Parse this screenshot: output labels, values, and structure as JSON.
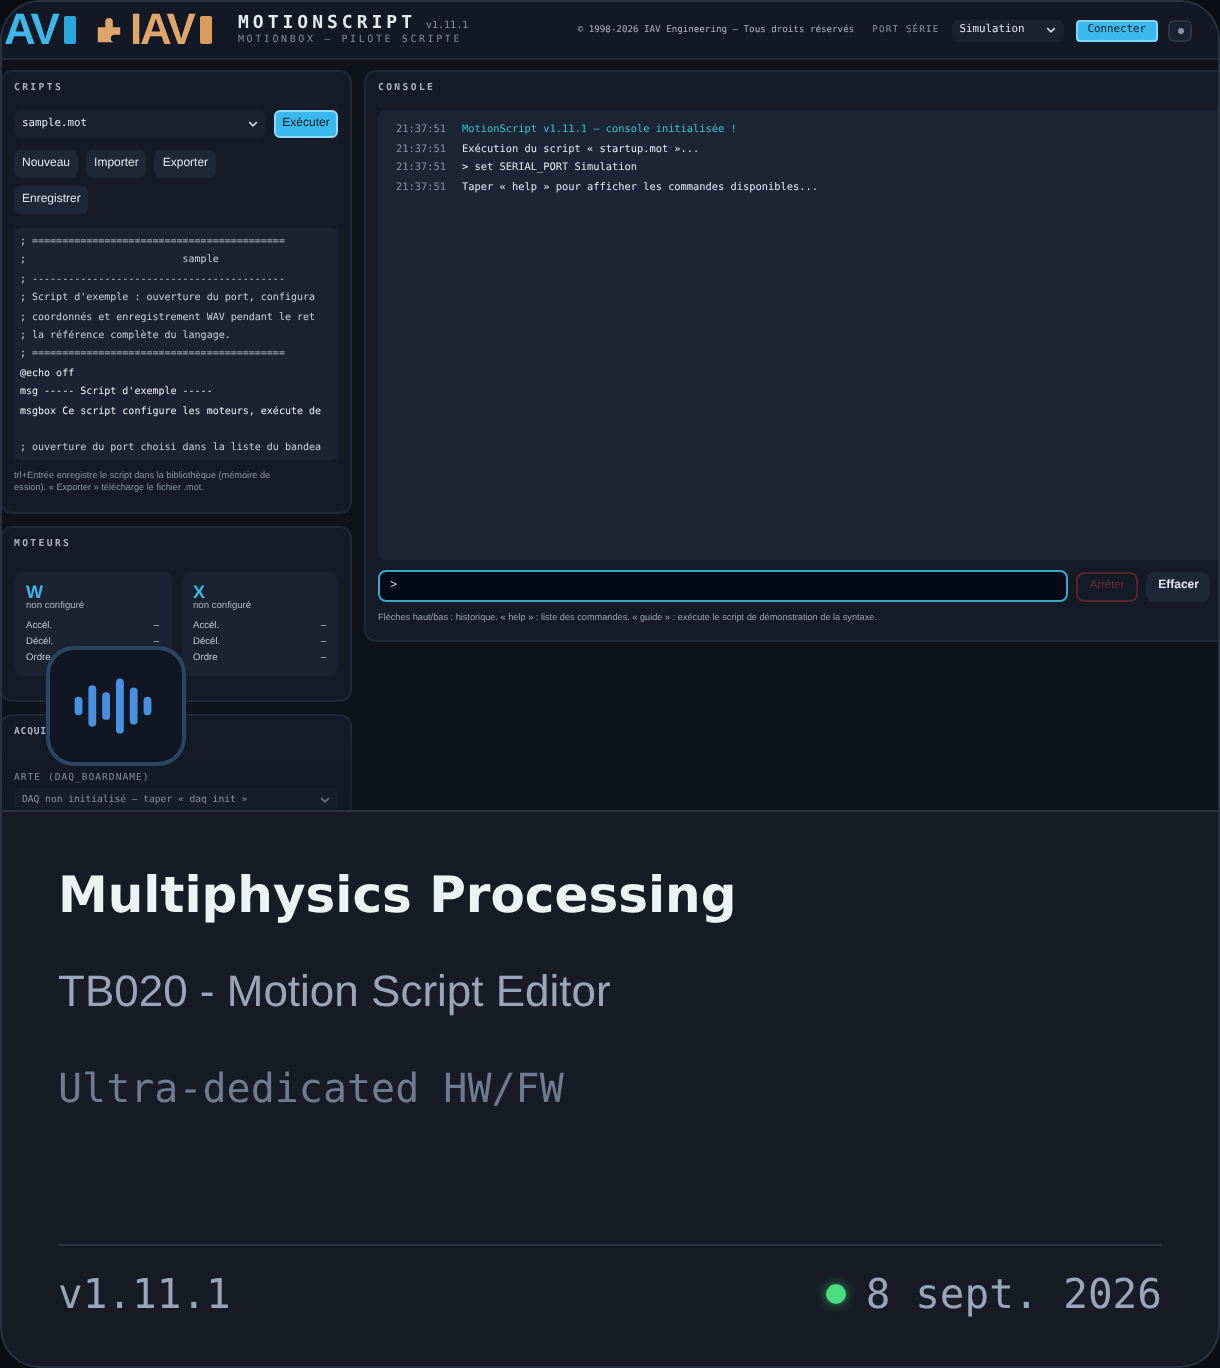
{
  "preview": {
    "header": {
      "logos": [
        "AV",
        "IAV"
      ],
      "title": "MOTIONSCRIPT",
      "version": "v1.11.1",
      "subtitle": "MOTIONBOX — PILOTE SCRIPTE",
      "copyright": "© 1998-2026 IAV Engineering — Tous droits réservés",
      "port_label": "PORT SÉRIE",
      "port_value": "Simulation",
      "connect_button": "Connecter"
    },
    "scripts": {
      "heading": "CRIPTS",
      "file": "sample.mot",
      "run_button": "Exécuter",
      "buttons": [
        "Nouveau",
        "Importer",
        "Exporter",
        "Enregistrer"
      ],
      "code_blocks": [
        [
          {
            "text": "; ==========================================",
            "kind": "comment"
          },
          {
            "text": ";                          sample",
            "kind": "comment"
          },
          {
            "text": "; ------------------------------------------",
            "kind": "comment"
          },
          {
            "text": "; Script d'exemple : ouverture du port, configura",
            "kind": "comment"
          },
          {
            "text": "; coordonnés et enregistrement WAV pendant le ret",
            "kind": "comment"
          },
          {
            "text": "; la référence complète du langage.",
            "kind": "comment"
          },
          {
            "text": "; ==========================================",
            "kind": "comment"
          },
          {
            "text": "@echo off",
            "kind": "command"
          },
          {
            "text": "msg ----- Script d'exemple -----",
            "kind": "command"
          },
          {
            "text": "msgbox Ce script configure les moteurs, exécute de",
            "kind": "command"
          }
        ],
        [
          {
            "text": "; ouverture du port choisi dans la liste du bandea",
            "kind": "comment"
          }
        ]
      ],
      "help_lines": [
        "trl+Entrée enregistre le script dans la bibliothèque (mémoire de",
        "ession). « Exporter » télécharge le fichier .mot."
      ]
    },
    "motors": {
      "heading": "MOTEURS",
      "items": [
        {
          "axis": "W",
          "status": "non configuré",
          "params": [
            {
              "label": "Accél.",
              "value": "–"
            },
            {
              "label": "Décél.",
              "value": "–"
            },
            {
              "label": "Ordre"
            }
          ]
        },
        {
          "axis": "X",
          "status": "non configuré",
          "params": [
            {
              "label": "Accél.",
              "value": "–"
            },
            {
              "label": "Décél.",
              "value": "–"
            },
            {
              "label": "Ordre",
              "value": "–"
            }
          ]
        }
      ]
    },
    "acquisition": {
      "heading": "ACQUI",
      "field_label": "ARTE (DAQ_BOARDNAME)",
      "select_value": "DAQ non initialisé — taper « daq init »"
    },
    "console": {
      "heading": "CONSOLE",
      "lines": [
        {
          "time": "21:37:51",
          "text": "MotionScript v1.11.1 — console initialisée !",
          "kind": "info"
        },
        {
          "time": "21:37:51",
          "text": "Exécution du script « startup.mot »...",
          "kind": "normal"
        },
        {
          "time": "21:37:51",
          "text": "> set SERIAL_PORT Simulation",
          "kind": "normal"
        },
        {
          "time": "21:37:51",
          "text": "Taper « help » pour afficher les commandes disponibles...",
          "kind": "normal"
        }
      ],
      "prompt": ">",
      "stop_button": {
        "label": "Arrêter",
        "disabled": true
      },
      "clear_button": "Effacer",
      "help": "Flèches haut/bas : historique. « help » : liste des commandes. « guide » : exécute le script de démonstration de la syntaxe."
    }
  },
  "title": "Multiphysics Processing",
  "subtitle": "TB020 - Motion Script Editor",
  "tagline": "Ultra-dedicated HW/FW",
  "version": "v1.11.1",
  "date": "8 sept. 2026"
}
